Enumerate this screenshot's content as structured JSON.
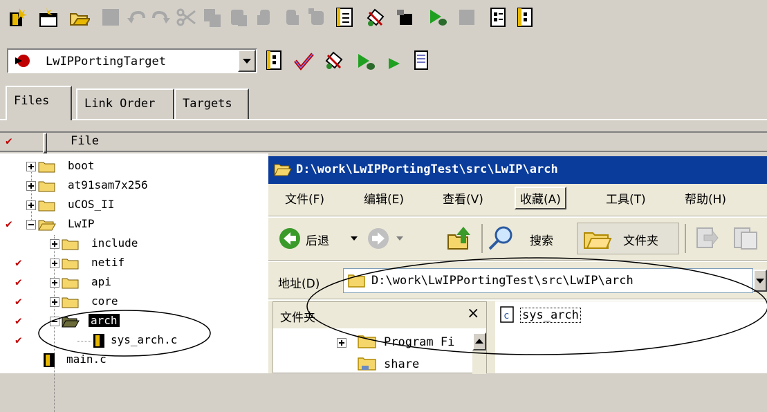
{
  "target_combo": {
    "value": "LwIPPortingTarget"
  },
  "tabs": [
    {
      "label": "Files",
      "active": true
    },
    {
      "label": "Link Order",
      "active": false
    },
    {
      "label": "Targets",
      "active": false
    }
  ],
  "file_header": {
    "label": "File"
  },
  "tree": {
    "items": [
      {
        "label": "boot"
      },
      {
        "label": "at91sam7x256"
      },
      {
        "label": "uCOS_II"
      },
      {
        "label": "LwIP"
      },
      {
        "label": "include"
      },
      {
        "label": "netif"
      },
      {
        "label": "api"
      },
      {
        "label": "core"
      },
      {
        "label": "arch"
      },
      {
        "label": "sys_arch.c"
      },
      {
        "label": "main.c"
      }
    ]
  },
  "explorer": {
    "title": "D:\\work\\LwIPPortingTest\\src\\LwIP\\arch",
    "menu": [
      "文件(F)",
      "编辑(E)",
      "查看(V)",
      "收藏(A)",
      "工具(T)",
      "帮助(H)"
    ],
    "back_label": "后退",
    "search_label": "搜索",
    "folders_label": "文件夹",
    "address_label": "地址(D)",
    "address_value": "D:\\work\\LwIPPortingTest\\src\\LwIP\\arch",
    "folders_pane_title": "文件夹",
    "close_glyph": "×",
    "folder_items": [
      "Program Fi",
      "share"
    ],
    "files": [
      "sys_arch"
    ]
  },
  "colors": {
    "titlebar": "#0a3c9b",
    "check": "#c00000",
    "folder": "#f5d66b",
    "highlight": "#000000"
  }
}
